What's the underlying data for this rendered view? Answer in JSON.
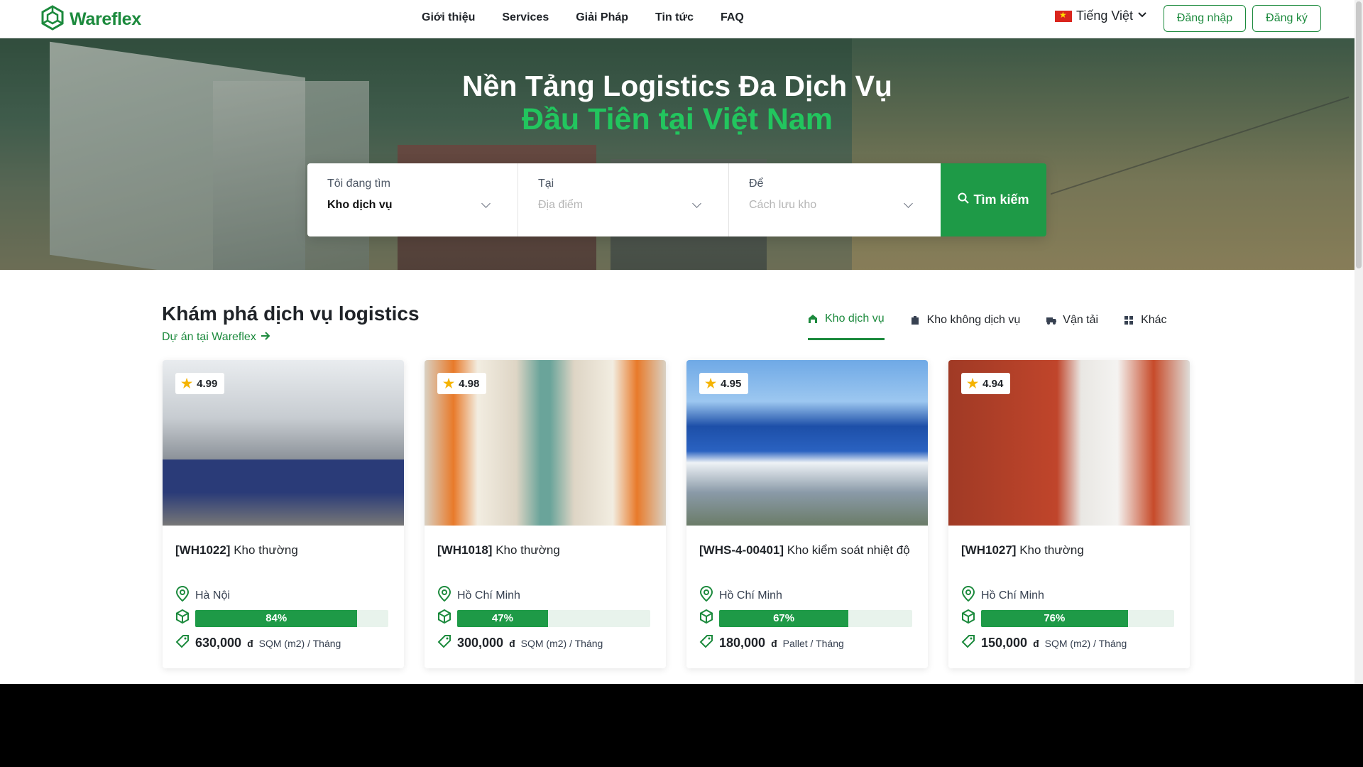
{
  "brand": {
    "name": "Wareflex",
    "accent": "#1c8a3d"
  },
  "nav": {
    "items": [
      "Giới thiệu",
      "Services",
      "Giải Pháp",
      "Tin tức",
      "FAQ"
    ]
  },
  "header": {
    "language": "Tiếng Việt",
    "login": "Đăng nhập",
    "register": "Đăng ký"
  },
  "hero": {
    "title": "Nền Tảng Logistics Đa Dịch Vụ",
    "subtitle": "Đầu Tiên tại Việt Nam",
    "search": {
      "looking_label": "Tôi đang tìm",
      "looking_value": "Kho dịch vụ",
      "at_label": "Tại",
      "at_placeholder": "Địa điểm",
      "for_label": "Để",
      "for_placeholder": "Cách lưu kho",
      "button": "Tìm kiếm"
    }
  },
  "section": {
    "title": "Khám phá dịch vụ logistics",
    "link": "Dự án tại Wareflex",
    "tabs": [
      "Kho dịch vụ",
      "Kho không dịch vụ",
      "Vận tải",
      "Khác"
    ],
    "active_tab": 0
  },
  "cards": [
    {
      "rating": "4.99",
      "code": "[WH1022]",
      "type": "Kho thường",
      "location": "Hà Nội",
      "capacity": "84%",
      "capacity_fraction": 0.84,
      "price": "630,000",
      "currency": "đ",
      "unit": "SQM (m2) / Tháng"
    },
    {
      "rating": "4.98",
      "code": "[WH1018]",
      "type": "Kho thường",
      "location": "Hồ Chí Minh",
      "capacity": "47%",
      "capacity_fraction": 0.47,
      "price": "300,000",
      "currency": "đ",
      "unit": "SQM (m2) / Tháng"
    },
    {
      "rating": "4.95",
      "code": "[WHS-4-00401]",
      "type": "Kho kiểm soát nhiệt độ",
      "location": "Hồ Chí Minh",
      "capacity": "67%",
      "capacity_fraction": 0.67,
      "price": "180,000",
      "currency": "đ",
      "unit": "Pallet / Tháng"
    },
    {
      "rating": "4.94",
      "code": "[WH1027]",
      "type": "Kho thường",
      "location": "Hồ Chí Minh",
      "capacity": "76%",
      "capacity_fraction": 0.76,
      "price": "150,000",
      "currency": "đ",
      "unit": "SQM (m2) / Tháng"
    }
  ],
  "icons": {
    "logo": "hexagon-cube-logo",
    "language": "vietnam-flag-icon",
    "dropdown": "chevron-down-icon",
    "search": "search-icon",
    "arrow": "arrow-right-icon",
    "location": "map-pin-icon",
    "capacity": "box-icon",
    "price": "price-tag-icon",
    "rating": "star-icon"
  }
}
